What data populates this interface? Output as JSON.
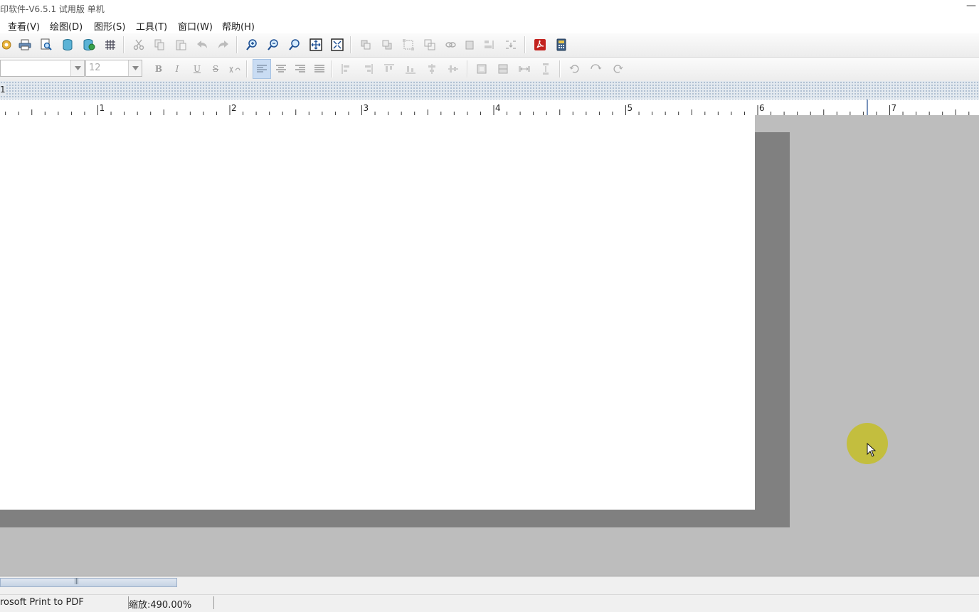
{
  "window": {
    "title": "印软件-V6.5.1 试用版 单机",
    "minimize_glyph": "—"
  },
  "menu": [
    {
      "label": "查看(V)"
    },
    {
      "label": "绘图(D)"
    },
    {
      "label": "图形(S)"
    },
    {
      "label": "工具(T)"
    },
    {
      "label": "窗口(W)"
    },
    {
      "label": "帮助(H)"
    }
  ],
  "toolbar_format": {
    "font_name": "",
    "font_size": "12",
    "bold": "B",
    "italic": "I",
    "underline": "U",
    "strike": "S"
  },
  "tab": {
    "label": "1"
  },
  "ruler": {
    "labels": [
      "1",
      "2",
      "3",
      "4",
      "5",
      "6",
      "7"
    ]
  },
  "status": {
    "printer": "rosoft Print to PDF",
    "zoom": "缩放:490.00%"
  },
  "colors": {
    "canvas_bg": "#bdbdbd",
    "page_shadow": "#808080",
    "accent": "#4a6fa5",
    "cursor_highlight": "#c4be28"
  }
}
